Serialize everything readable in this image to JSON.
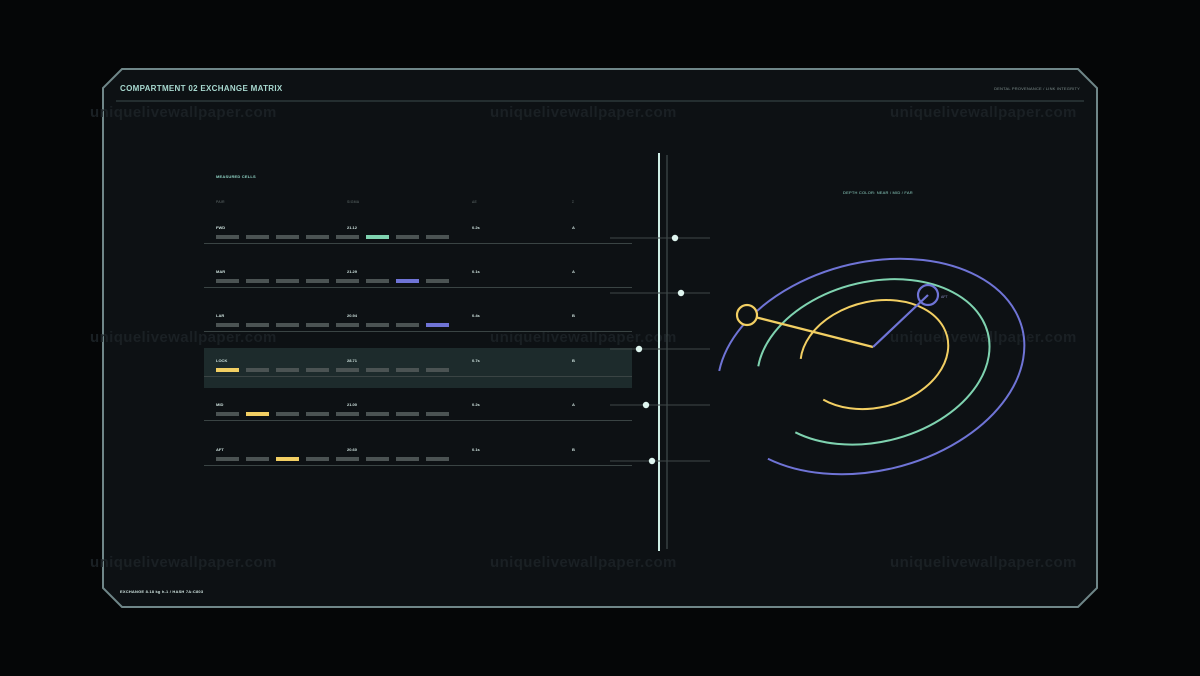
{
  "header": {
    "title": "COMPARTMENT 02 EXCHANGE MATRIX",
    "subtitle": "DENTAL PROVENANCE / LINK INTEGRITY"
  },
  "footer": {
    "status": "EXCHANGE 8.18 kg h-1 / HASH 7A:C803"
  },
  "table": {
    "section_label": "MEASURED CELLS",
    "columns": [
      "PAIR",
      "SIGMA",
      "ΔE",
      "Σ"
    ],
    "rows": [
      {
        "name": "FWD",
        "value": "21.12",
        "delta": "0.2s",
        "grade": "A",
        "highlight_index": 5,
        "highlight_color": "#7fd3b0",
        "active": false
      },
      {
        "name": "MAR",
        "value": "21.29",
        "delta": "0.1s",
        "grade": "A",
        "highlight_index": 6,
        "highlight_color": "#6f74d6",
        "active": false
      },
      {
        "name": "LAR",
        "value": "20.94",
        "delta": "0.4s",
        "grade": "B",
        "highlight_index": 7,
        "highlight_color": "#6f74d6",
        "active": false
      },
      {
        "name": "LOCK",
        "value": "28.71",
        "delta": "0.7s",
        "grade": "B",
        "highlight_index": 0,
        "highlight_color": "#f2cf63",
        "active": true
      },
      {
        "name": "MID",
        "value": "21.00",
        "delta": "0.2s",
        "grade": "A",
        "highlight_index": 1,
        "highlight_color": "#f2cf63",
        "active": false
      },
      {
        "name": "AFT",
        "value": "20.60",
        "delta": "0.1s",
        "grade": "B",
        "highlight_index": 2,
        "highlight_color": "#f2cf63",
        "active": false
      }
    ],
    "slider_fractions": [
      0.65,
      0.71,
      0.29,
      0.36,
      0.42
    ]
  },
  "radar": {
    "legend": "DEPTH COLOR: NEAR / MID / FAR",
    "marker_label": "AFT",
    "colors": {
      "near": "#f2cf63",
      "mid": "#7fd3b0",
      "far": "#6f74d6"
    }
  },
  "watermark": "uniquelivewallpaper.com",
  "colors": {
    "frame": "#6f8688",
    "panel": "#0d1114",
    "accent": "#a7d8cf",
    "spine": "#cfeee6"
  }
}
